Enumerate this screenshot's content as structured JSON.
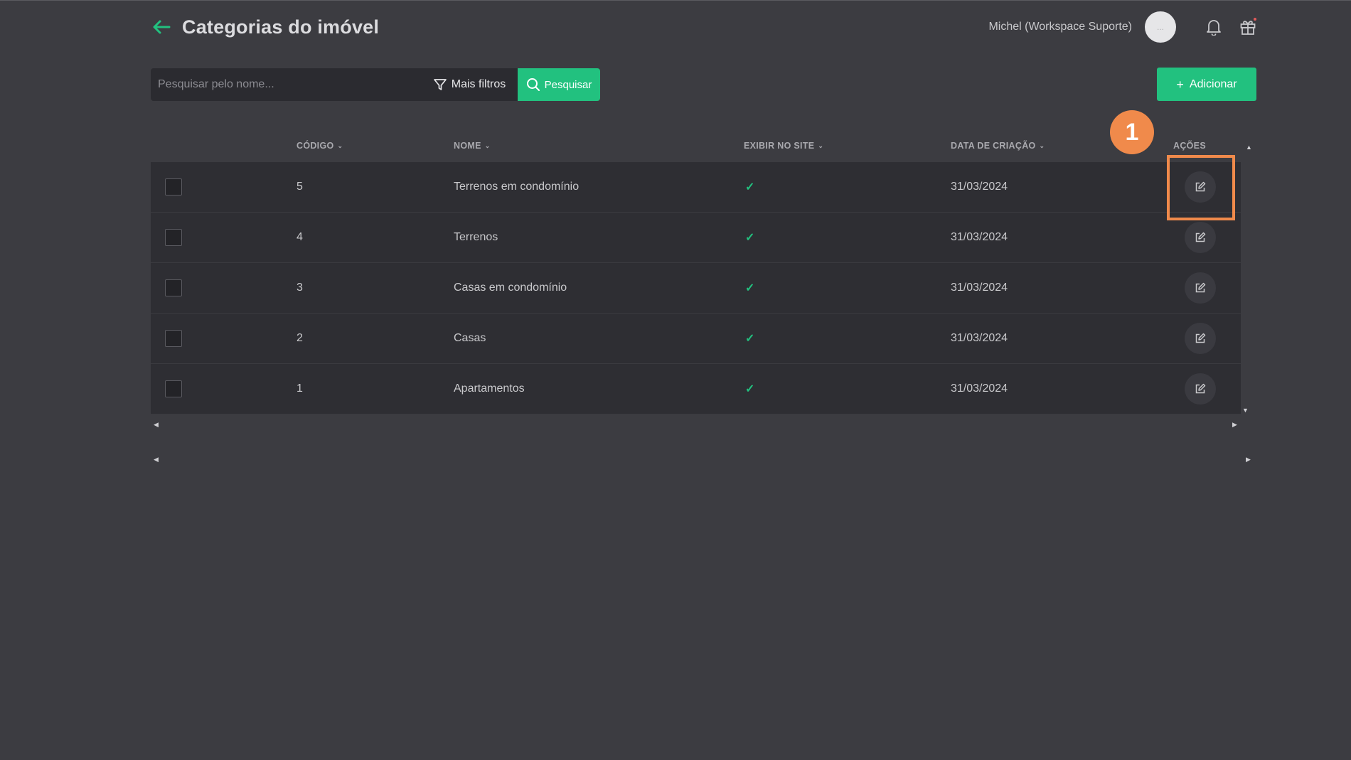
{
  "header": {
    "back_icon": "arrow-left-icon",
    "title": "Categorias do imóvel",
    "user_name": "Michel (Workspace Suporte)",
    "avatar_text": "...",
    "notification_icon": "bell-icon",
    "gift_icon": "gift-icon"
  },
  "search": {
    "placeholder": "Pesquisar pelo nome...",
    "value": "",
    "filters_label": "Mais filtros",
    "search_label": "Pesquisar"
  },
  "add_button": {
    "label": "Adicionar"
  },
  "table": {
    "columns": [
      "CÓDIGO",
      "NOME",
      "EXIBIR NO SITE",
      "DATA DE CRIAÇÃO",
      "AÇÕES"
    ],
    "rows": [
      {
        "codigo": "5",
        "nome": "Terrenos em condomínio",
        "exibir": true,
        "data": "31/03/2024"
      },
      {
        "codigo": "4",
        "nome": "Terrenos",
        "exibir": true,
        "data": "31/03/2024"
      },
      {
        "codigo": "3",
        "nome": "Casas em condomínio",
        "exibir": true,
        "data": "31/03/2024"
      },
      {
        "codigo": "2",
        "nome": "Casas",
        "exibir": true,
        "data": "31/03/2024"
      },
      {
        "codigo": "1",
        "nome": "Apartamentos",
        "exibir": true,
        "data": "31/03/2024"
      }
    ]
  },
  "callout": {
    "number": "1"
  },
  "colors": {
    "background": "#3c3c41",
    "row": "#2e2e33",
    "accent": "#22c17f",
    "callout": "#f08a4b"
  }
}
